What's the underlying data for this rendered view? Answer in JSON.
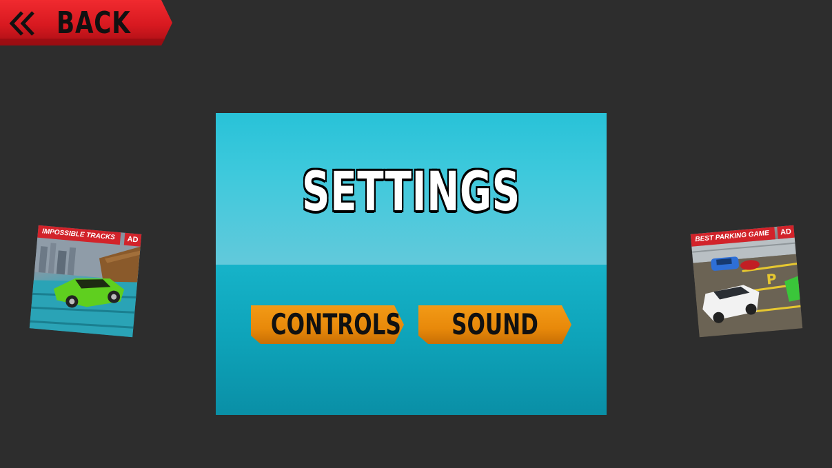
{
  "header": {
    "back_label": "BACK"
  },
  "panel": {
    "title": "SETTINGS",
    "buttons": [
      {
        "label": "CONTROLS"
      },
      {
        "label": "SOUND"
      }
    ]
  },
  "ads": [
    {
      "title": "IMPOSSIBLE TRACKS",
      "badge": "AD"
    },
    {
      "title": "BEST PARKING GAME",
      "badge": "AD"
    }
  ],
  "colors": {
    "back_red": "#d81920",
    "button_orange": "#e8890a",
    "panel_top": "#3ec9dc",
    "panel_bottom": "#0ea3b9",
    "background": "#2d2d2d"
  },
  "icons": {
    "back": "double-chevron-left-icon"
  }
}
